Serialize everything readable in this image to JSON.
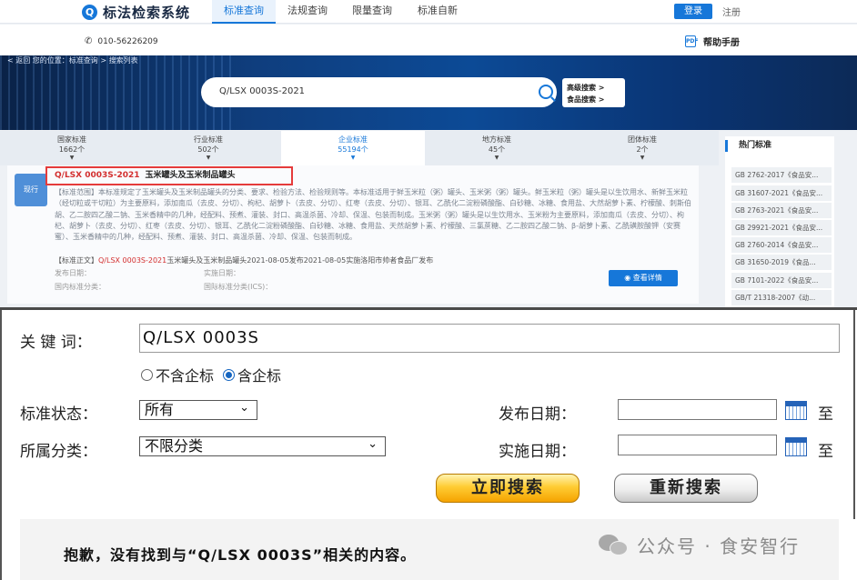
{
  "app": {
    "logo_glyph": "Q",
    "title": "标法检索系统"
  },
  "nav": {
    "tabs": [
      {
        "label": "标准查询",
        "active": true
      },
      {
        "label": "法规查询",
        "active": false
      },
      {
        "label": "限量查询",
        "active": false
      },
      {
        "label": "标准自新",
        "active": false
      }
    ],
    "login_label": "登录",
    "register_label": "注册"
  },
  "subbar": {
    "phone": "010-56226209",
    "help_label": "帮助手册"
  },
  "banner": {
    "breadcrumb": "< 返回      您的位置：标准查询 > 搜索列表",
    "search_value": "Q/LSX 0003S-2021",
    "advanced_search": "高级搜索 >",
    "food_search": "食品搜索 >"
  },
  "category_tabs": [
    {
      "label": "国家标准",
      "count": "1662个",
      "active": false
    },
    {
      "label": "行业标准",
      "count": "502个",
      "active": false
    },
    {
      "label": "企业标准",
      "count": "55194个",
      "active": true
    },
    {
      "label": "地方标准",
      "count": "45个",
      "active": false
    },
    {
      "label": "团体标准",
      "count": "2个",
      "active": false
    }
  ],
  "result": {
    "icon_label": "现行",
    "code": "Q/LSX 0003S-2021",
    "name": "玉米罐头及玉米制品罐头",
    "scope": "【标准范围】本标准规定了玉米罐头及玉米制品罐头的分类、要求、检验方法、检验规则等。本标准适用于鲜玉米粒（粥）罐头、玉米粥（粥）罐头。鲜玉米粒（粥）罐头是以生饮用水、新鲜玉米粒（经切粒或干切粒）为主要原料，添加南瓜（去皮、分切）、枸杞、胡萝卜（去皮、分切）、红枣（去皮、分切）、银耳、乙酰化二淀粉磷酸酯、白砂糖、冰糖、食用盐、大然胡萝卜素、柠檬酸、刺斯伯胡、乙二胺四乙酸二钠、玉米香精中的几种，经配料、预煮、灌装、封口、高温杀菌、冷却、保温、包装而制成。玉米粥（粥）罐头是以生饮用水、玉米粉为主要原料，添加南瓜（去皮、分切）、枸杞、胡萝卜（去皮、分切）、红枣（去皮、分切）、银耳、乙酰化二淀粉磷酸酯、白砂糖、冰糖、食用盐、天然胡萝卜素、柠檬酸、三氯蔗糖、乙二胺四乙酸二钠、β-胡萝卜素、乙酰磺胺酸钾（安赛蜜）、玉米香精中的几种，经配料、预煮、灌装、封口、高温杀菌、冷却、保温、包装而制成。",
    "replace_prefix": "【标准正文】",
    "replace_highlight": "Q/LSX 0003S-2021",
    "replace_text": "玉米罐头及玉米制品罐头2021-08-05发布2021-08-05实施洛阳市帅者食品厂发布",
    "publish_date_label": "发布日期：",
    "impl_date_label": "实施日期：",
    "ccs_label": "国内标准分类：",
    "ics_label": "国际标准分类(ICS)：",
    "view_label": "查看详情"
  },
  "hot": {
    "title": "热门标准",
    "items": [
      "GB 2762-2017《食品安...",
      "GB 31607-2021《食品安...",
      "GB 2763-2021《食品安...",
      "GB 29921-2021《食品安...",
      "GB 2760-2014《食品安...",
      "GB 31650-2019《食品...",
      "GB 7101-2022《食品安...",
      "GB/T 21318-2007《动..."
    ]
  },
  "form": {
    "keyword_label": "关 键 词：",
    "keyword_value": "Q/LSX 0003S",
    "radio_exclude": "不含企标",
    "radio_include": "含企标",
    "status_label": "标准状态：",
    "status_value": "所有",
    "category_label": "所属分类：",
    "category_value": "不限分类",
    "publish_label": "发布日期：",
    "impl_label": "实施日期：",
    "to_label": "至",
    "search_btn": "立即搜索",
    "reset_btn": "重新搜索",
    "no_result": "抱歉，没有找到与“Q/LSX 0003S”相关的内容。"
  },
  "watermark": {
    "text": "公众号 · 食安智行"
  }
}
